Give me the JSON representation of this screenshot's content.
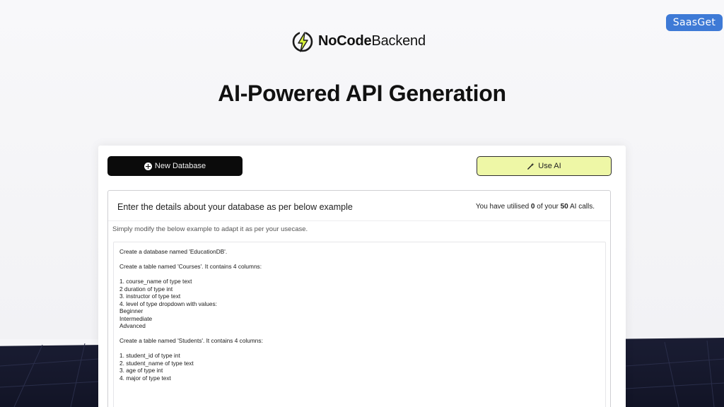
{
  "badge": {
    "label": "SaasGet"
  },
  "brand": {
    "name_bold": "NoCode",
    "name_regular": "Backend"
  },
  "headline": "AI-Powered API Generation",
  "buttons": {
    "new_database": "New Database",
    "use_ai": "Use AI"
  },
  "panel": {
    "title": "Enter the details about your database as per below example",
    "usage_prefix": "You have utilised ",
    "usage_used": "0",
    "usage_middle": " of your ",
    "usage_total": "50",
    "usage_suffix": " AI calls.",
    "hint": "Simply modify the below example to adapt it as per your usecase.",
    "example_lines": [
      "Create a database named 'EducationDB'.",
      "",
      "Create a table named 'Courses'. It contains 4 columns:",
      "",
      "1. course_name of type text",
      "2 duration of type int",
      "3. instructor of type text",
      "4. level of type dropdown with values:",
      "Beginner",
      "Intermediate",
      "Advanced",
      "",
      "Create a table named 'Students'. It contains 4 columns:",
      "",
      "1. student_id of type int",
      "2. student_name of type text",
      "3. age of type int",
      "4. major of type text"
    ]
  },
  "icons": {
    "logo": "lightning-bolt-logo-icon",
    "new_database": "plus-circle-icon",
    "use_ai": "magic-wand-icon"
  },
  "colors": {
    "badge": "#3e7ad6",
    "new_database_button": "#0b0b0b",
    "use_ai_button": "#eef7a6",
    "dark_footer": "#1a1d33",
    "logo_accent": "#d6ef3a"
  }
}
